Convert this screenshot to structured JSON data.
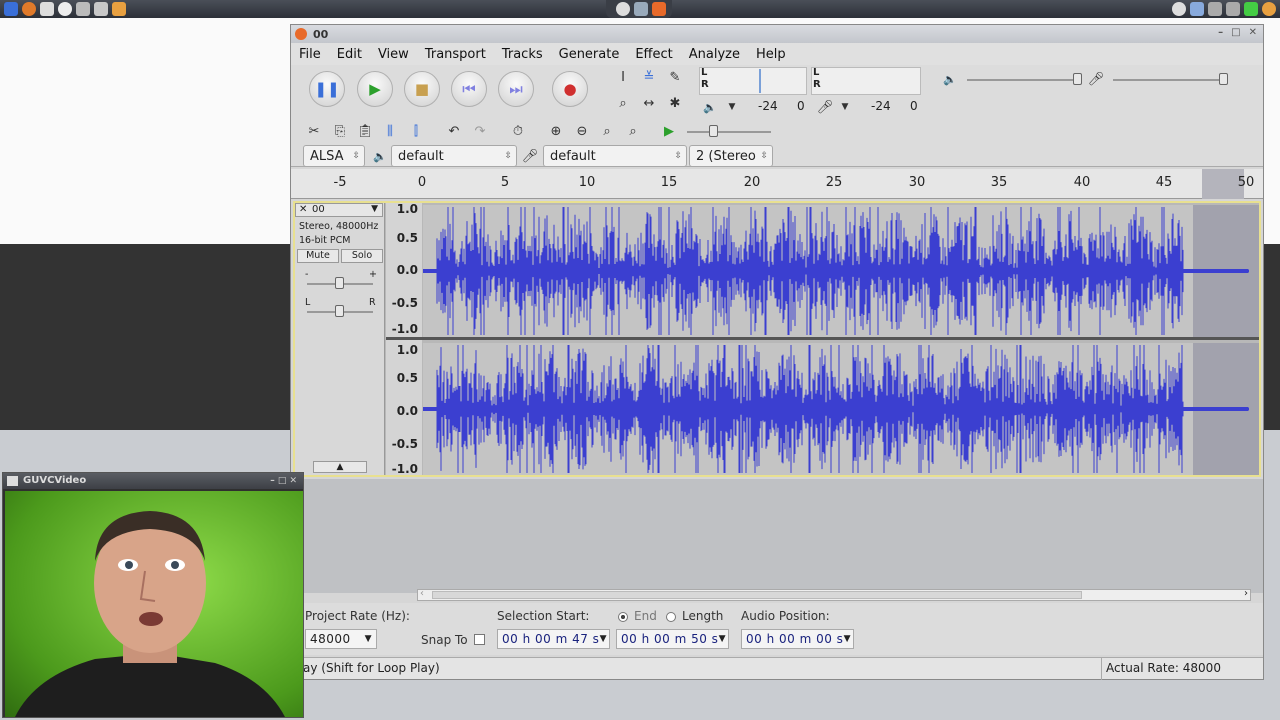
{
  "window": {
    "title": "00"
  },
  "menu": [
    "File",
    "Edit",
    "View",
    "Transport",
    "Tracks",
    "Generate",
    "Effect",
    "Analyze",
    "Help"
  ],
  "meters": {
    "playback_label_l": "L",
    "playback_label_r": "R",
    "record_label_l": "L",
    "record_label_r": "R",
    "playback_scale": [
      "-24",
      "0"
    ],
    "record_scale": [
      "-24",
      "0"
    ]
  },
  "device": {
    "host": "ALSA",
    "output": "default",
    "input": "default",
    "channels": "2 (Stereo"
  },
  "ruler": [
    "-5",
    "0",
    "5",
    "10",
    "15",
    "20",
    "25",
    "30",
    "35",
    "40",
    "45",
    "50"
  ],
  "track": {
    "name": "00",
    "info1": "Stereo, 48000Hz",
    "info2": "16-bit PCM",
    "mute": "Mute",
    "solo": "Solo",
    "gain_minus": "-",
    "gain_plus": "+",
    "pan_l": "L",
    "pan_r": "R"
  },
  "vaxis": [
    "1.0",
    "0.5",
    "0.0",
    "-0.5",
    "-1.0"
  ],
  "bottom": {
    "project_rate_label": "Project Rate (Hz):",
    "project_rate": "48000",
    "snap_label": "Snap To",
    "selection_label": "Selection Start:",
    "end_label": "End",
    "length_label": "Length",
    "audio_pos_label": "Audio Position:",
    "sel_start": "00 h 00 m 47 s",
    "sel_end": "00 h 00 m 50 s",
    "audio_pos": "00 h 00 m 00 s"
  },
  "status": {
    "left": "ay (Shift for Loop Play)",
    "right": "Actual Rate: 48000"
  },
  "webcam": {
    "title": "GUVCVideo"
  },
  "colors": {
    "wave": "#3b3fd0",
    "selection": "#9a9aa8",
    "track_border": "#e8e090"
  }
}
